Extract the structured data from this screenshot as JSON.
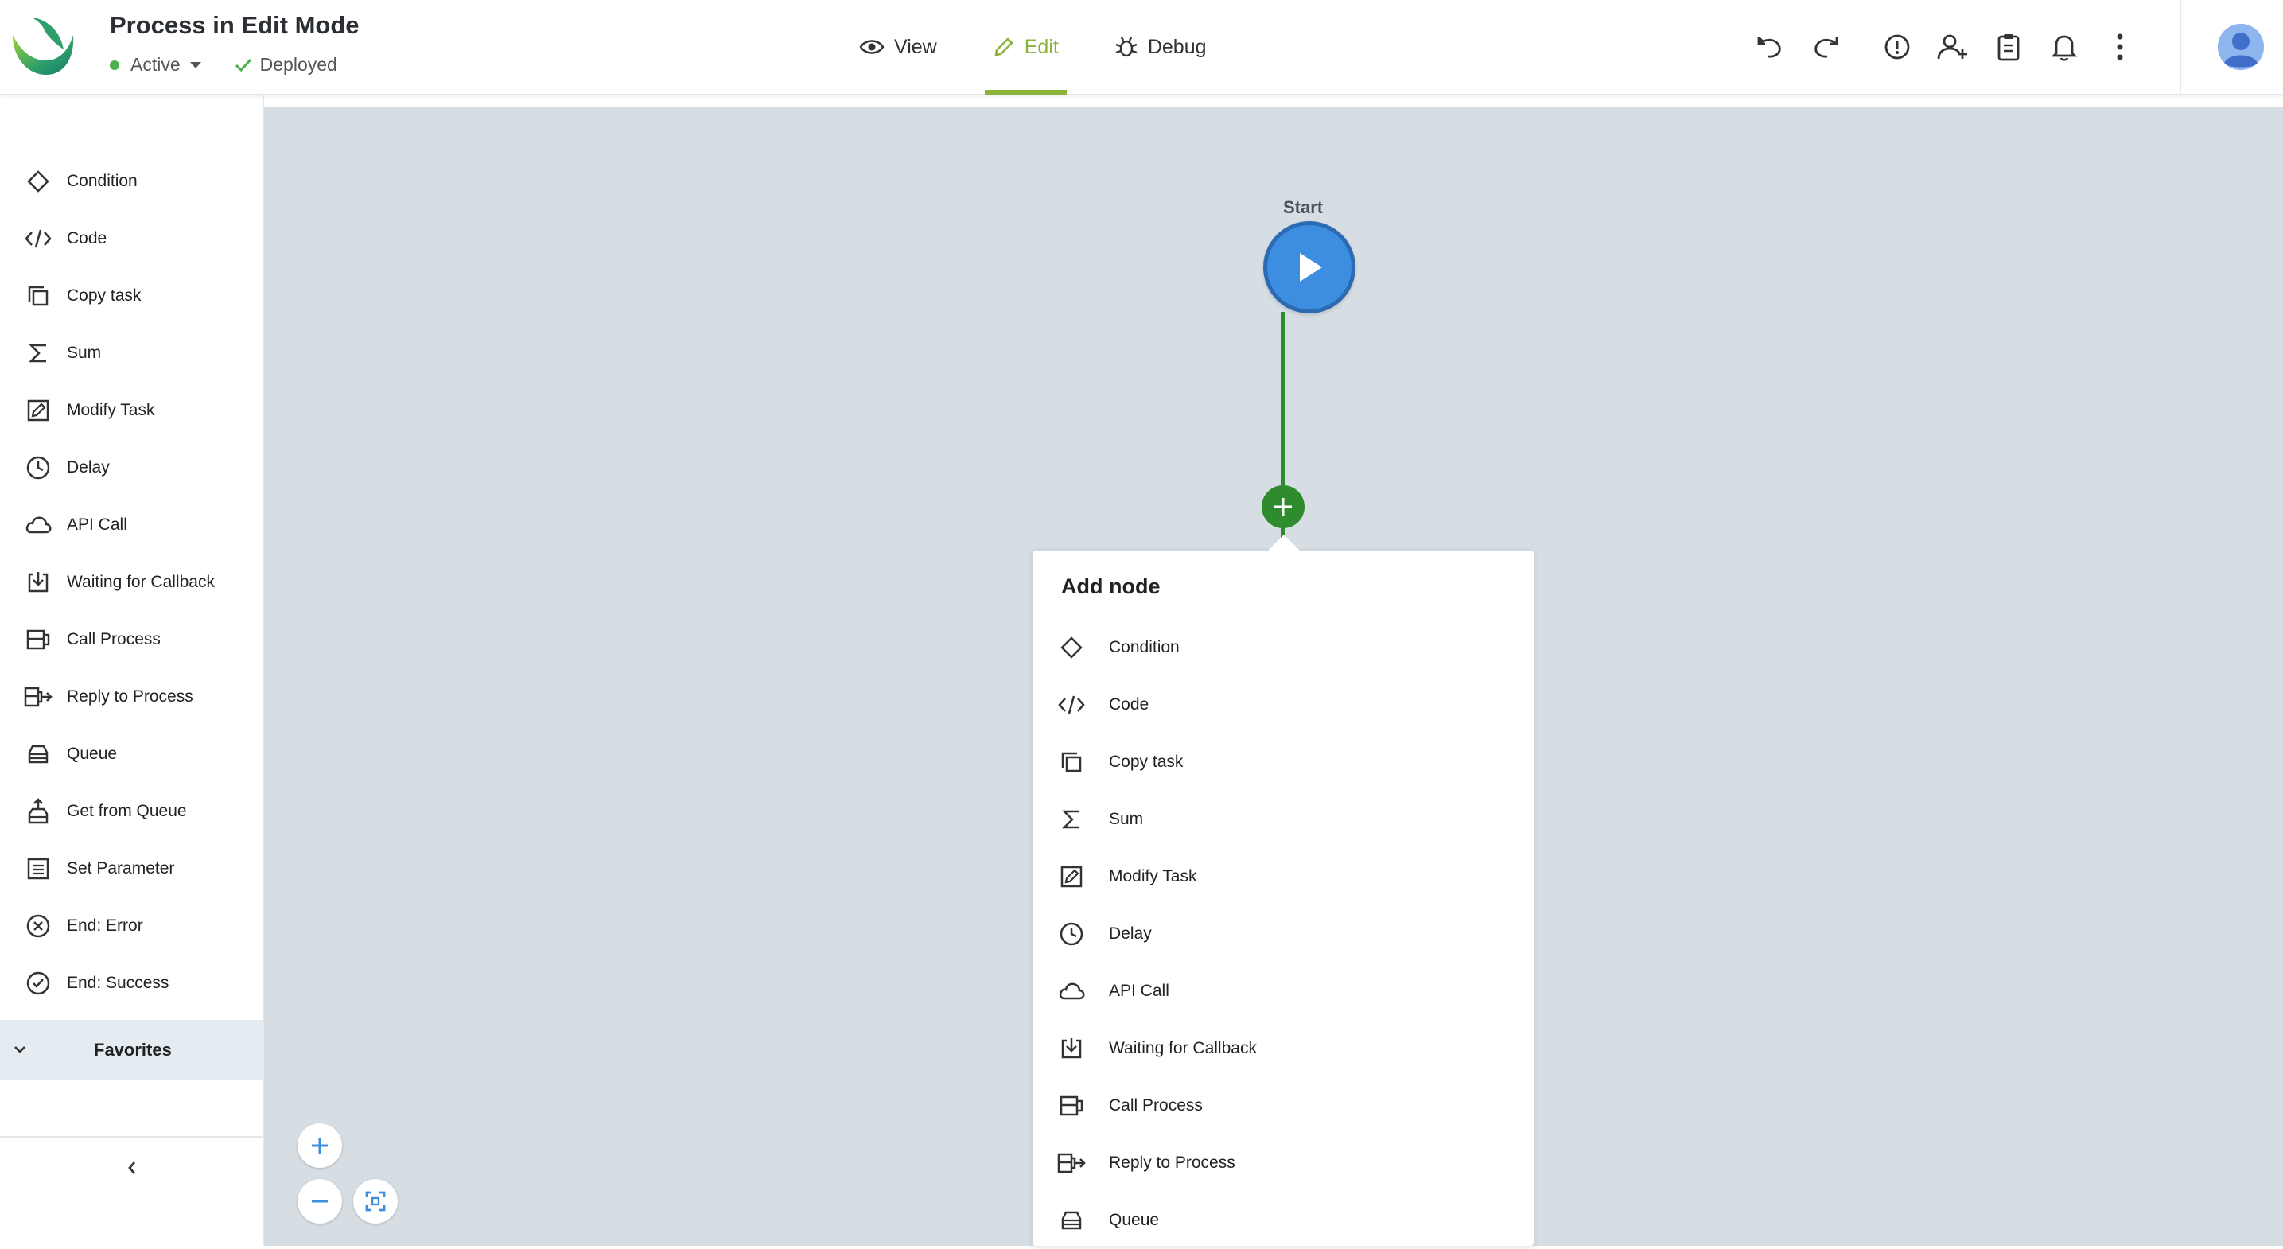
{
  "header": {
    "title": "Process in Edit Mode",
    "status": "Active",
    "deploy_state": "Deployed",
    "modes": [
      {
        "label": "View",
        "icon": "eye-icon"
      },
      {
        "label": "Edit",
        "icon": "pencil-icon",
        "active": true
      },
      {
        "label": "Debug",
        "icon": "bug-icon"
      }
    ],
    "tools": [
      "undo-icon",
      "redo-icon",
      "alert-icon",
      "add-user-icon",
      "clipboard-icon",
      "bell-icon",
      "more-vertical-icon"
    ]
  },
  "sidebar": {
    "items": [
      {
        "label": "Condition",
        "icon": "diamond-icon"
      },
      {
        "label": "Code",
        "icon": "code-icon"
      },
      {
        "label": "Copy task",
        "icon": "copy-icon"
      },
      {
        "label": "Sum",
        "icon": "sigma-icon"
      },
      {
        "label": "Modify Task",
        "icon": "edit-square-icon"
      },
      {
        "label": "Delay",
        "icon": "clock-icon"
      },
      {
        "label": "API Call",
        "icon": "cloud-icon"
      },
      {
        "label": "Waiting for Callback",
        "icon": "download-icon"
      },
      {
        "label": "Call Process",
        "icon": "call-process-icon"
      },
      {
        "label": "Reply to Process",
        "icon": "reply-process-icon"
      },
      {
        "label": "Queue",
        "icon": "inbox-icon"
      },
      {
        "label": "Get from Queue",
        "icon": "upload-tray-icon"
      },
      {
        "label": "Set Parameter",
        "icon": "list-icon"
      },
      {
        "label": "End: Error",
        "icon": "x-circle-icon"
      },
      {
        "label": "End: Success",
        "icon": "check-circle-icon"
      }
    ],
    "favorites_label": "Favorites"
  },
  "canvas": {
    "start_label": "Start",
    "popover": {
      "title": "Add node",
      "items": [
        "Condition",
        "Code",
        "Copy task",
        "Sum",
        "Modify Task",
        "Delay",
        "API Call",
        "Waiting for Callback",
        "Call Process",
        "Reply to Process",
        "Queue"
      ]
    }
  },
  "colors": {
    "accent": "#8bb33a",
    "start_node": "#3d8ee0",
    "edge": "#2e8b2e",
    "canvas_bg": "#d6dee4"
  }
}
